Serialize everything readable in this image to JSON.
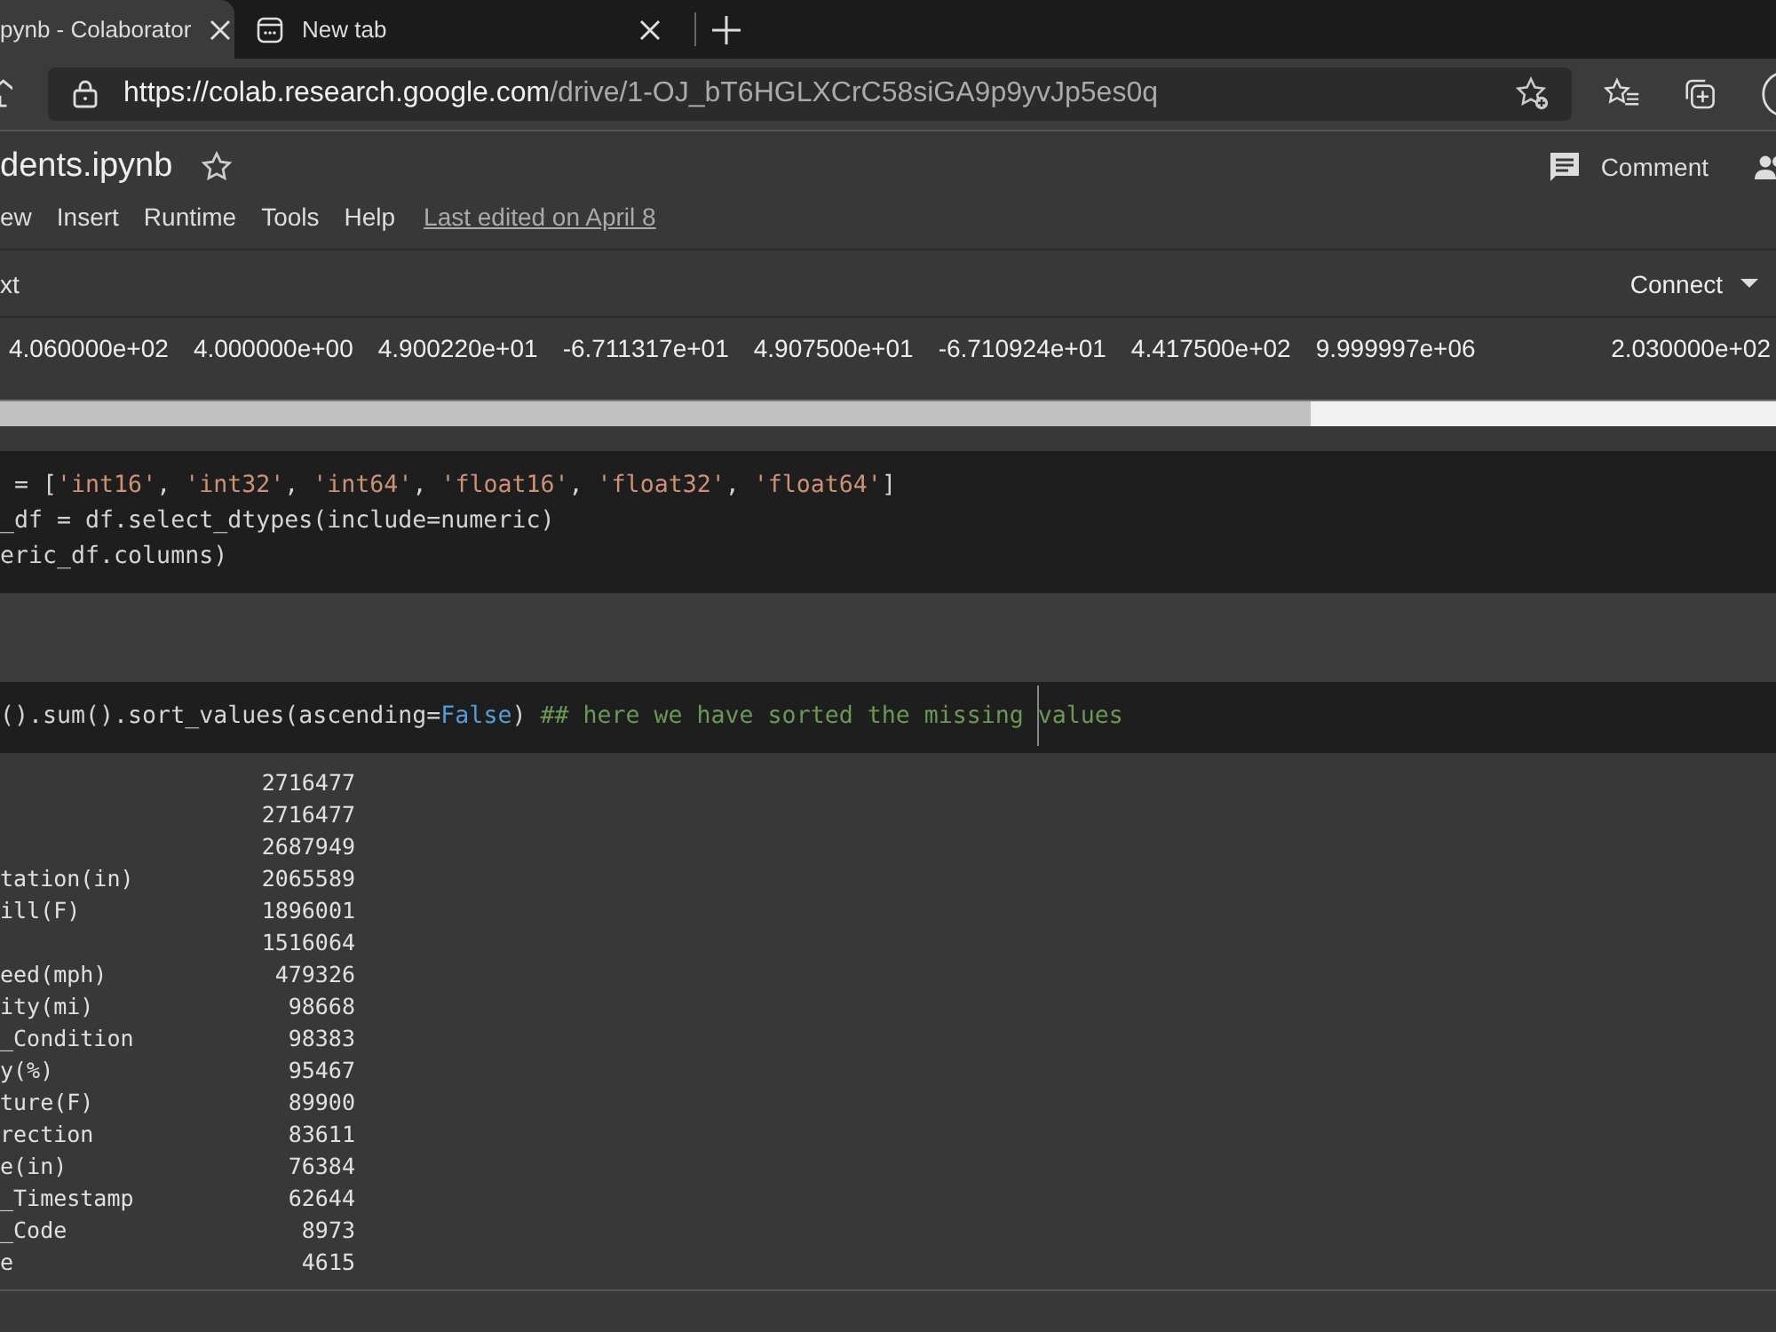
{
  "browser": {
    "tabs": [
      {
        "title": "pynb - Colaborator",
        "selected": true
      },
      {
        "title": "New tab",
        "selected": false
      }
    ],
    "address": {
      "host": "https://colab.research.google.com",
      "path": "/drive/1-OJ_bT6HGLXCrC58siGA9p9yvJp5es0q"
    }
  },
  "notebook": {
    "title": "dents.ipynb",
    "menu": [
      "ew",
      "Insert",
      "Runtime",
      "Tools",
      "Help"
    ],
    "last_edited": "Last edited on April 8",
    "comment": "Comment"
  },
  "toolbar": {
    "left": "xt",
    "connect": "Connect"
  },
  "output_values": [
    "4.060000e+02",
    "4.000000e+00",
    "4.900220e+01",
    "-6.711317e+01",
    "4.907500e+01",
    "-6.710924e+01",
    "4.417500e+02",
    "9.999997e+06",
    "2.030000e+02"
  ],
  "cell_1": [
    [
      {
        "kind": "plain",
        "text": " = ["
      },
      {
        "kind": "string",
        "text": "'int16'"
      },
      {
        "kind": "plain",
        "text": ", "
      },
      {
        "kind": "string",
        "text": "'int32'"
      },
      {
        "kind": "plain",
        "text": ", "
      },
      {
        "kind": "string",
        "text": "'int64'"
      },
      {
        "kind": "plain",
        "text": ", "
      },
      {
        "kind": "string",
        "text": "'float16'"
      },
      {
        "kind": "plain",
        "text": ", "
      },
      {
        "kind": "string",
        "text": "'float32'"
      },
      {
        "kind": "plain",
        "text": ", "
      },
      {
        "kind": "string",
        "text": "'float64'"
      },
      {
        "kind": "plain",
        "text": "]"
      }
    ],
    [
      {
        "kind": "plain",
        "text": "_df = df.select_dtypes(include=numeric)"
      }
    ],
    [
      {
        "kind": "plain",
        "text": "eric_df.columns)"
      }
    ]
  ],
  "cell_2": [
    [
      {
        "kind": "plain",
        "text": "().sum().sort_values(ascending="
      },
      {
        "kind": "keyword",
        "text": "False"
      },
      {
        "kind": "plain",
        "text": ") "
      },
      {
        "kind": "comment",
        "text": "## here we have sorted the missing values"
      }
    ]
  ],
  "missing_counts": [
    {
      "value": "2716477"
    },
    {
      "value": "2716477"
    },
    {
      "value": "2687949"
    },
    {
      "name": "tation(in)",
      "value": "2065589"
    },
    {
      "name": "ill(F)",
      "value": "1896001"
    },
    {
      "value": "1516064"
    },
    {
      "name": "eed(mph)",
      "value": "479326"
    },
    {
      "name": "ity(mi)",
      "value": "98668"
    },
    {
      "name": "_Condition",
      "value": "98383"
    },
    {
      "name": "y(%)",
      "value": "95467"
    },
    {
      "name": "ture(F)",
      "value": "89900"
    },
    {
      "name": "rection",
      "value": "83611"
    },
    {
      "name": "e(in)",
      "value": "76384"
    },
    {
      "name": "_Timestamp",
      "value": "62644"
    },
    {
      "name": "_Code",
      "value": "8973"
    },
    {
      "name": "e",
      "value": "4615"
    }
  ]
}
